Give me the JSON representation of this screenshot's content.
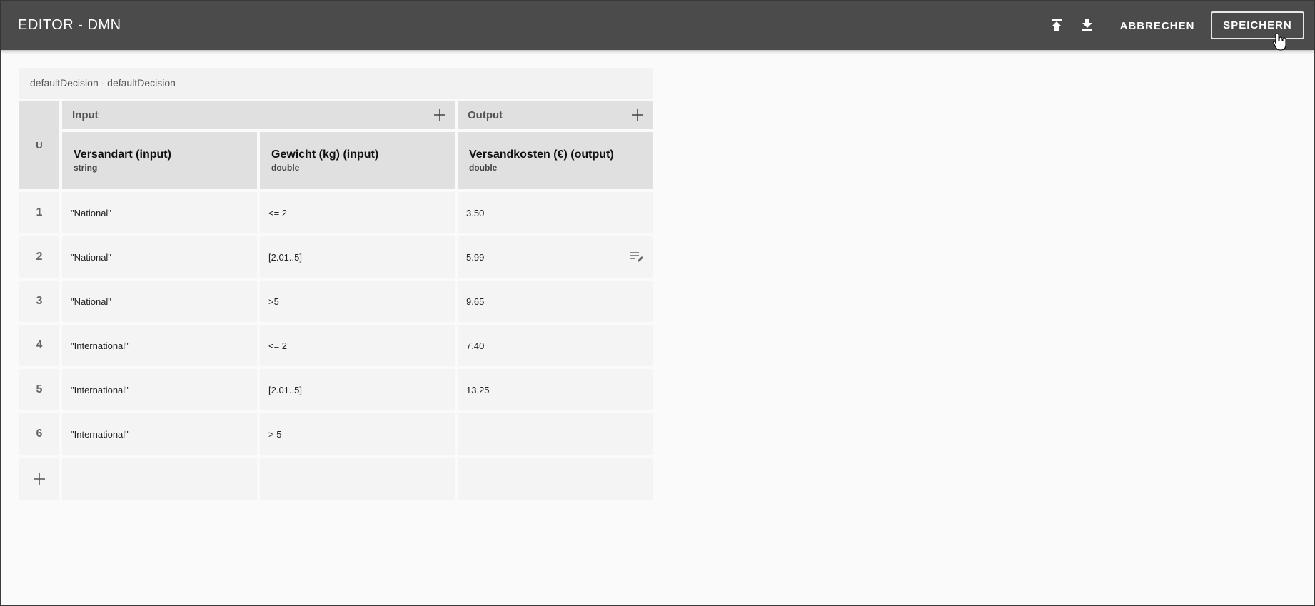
{
  "header": {
    "title": "EDITOR - DMN",
    "upload_icon": "upload-icon",
    "download_icon": "download-icon",
    "cancel_label": "ABBRECHEN",
    "save_label": "SPEICHERN"
  },
  "decision": {
    "name": "defaultDecision - defaultDecision",
    "hit_policy": "U",
    "input_group": "Input",
    "output_group": "Output",
    "columns": [
      {
        "name": "Versandart",
        "kind": "(input)",
        "type": "string"
      },
      {
        "name": "Gewicht (kg)",
        "kind": "(input)",
        "type": "double"
      },
      {
        "name": "Versandkosten (€)",
        "kind": "(output)",
        "type": "double"
      }
    ],
    "rules": [
      {
        "num": "1",
        "versandart": "\"National\"",
        "gewicht": "<= 2",
        "kosten": "3.50"
      },
      {
        "num": "2",
        "versandart": "\"National\"",
        "gewicht": "[2.01..5]",
        "kosten": "5.99"
      },
      {
        "num": "3",
        "versandart": "\"National\"",
        "gewicht": ">5",
        "kosten": "9.65"
      },
      {
        "num": "4",
        "versandart": "\"International\"",
        "gewicht": "<= 2",
        "kosten": "7.40"
      },
      {
        "num": "5",
        "versandart": "\"International\"",
        "gewicht": "[2.01..5]",
        "kosten": "13.25"
      },
      {
        "num": "6",
        "versandart": "\"International\"",
        "gewicht": "> 5",
        "kosten": "-"
      }
    ]
  },
  "colors": {
    "topbar": "#4b4b4b",
    "header_cell": "#e0e0e0",
    "cell": "#f4f4f4"
  }
}
